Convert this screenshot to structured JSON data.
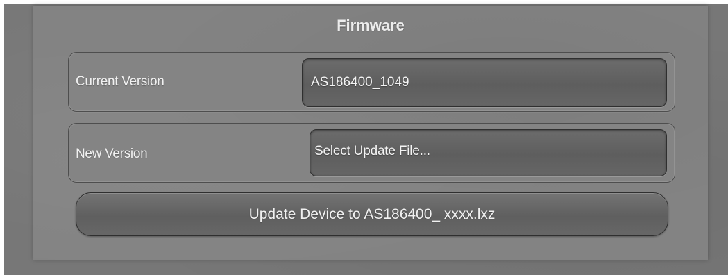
{
  "panel": {
    "title": "Firmware"
  },
  "current_version": {
    "label": "Current Version",
    "value": "AS186400_1049"
  },
  "new_version": {
    "label": "New Version",
    "select_label": "Select Update File..."
  },
  "update": {
    "button_label": "Update Device to AS186400_ xxxx.lxz"
  },
  "colors": {
    "background": "#777777",
    "panel": "#838383",
    "field": "#636363",
    "text": "#f1f1f1",
    "border": "#2f2f2f"
  }
}
